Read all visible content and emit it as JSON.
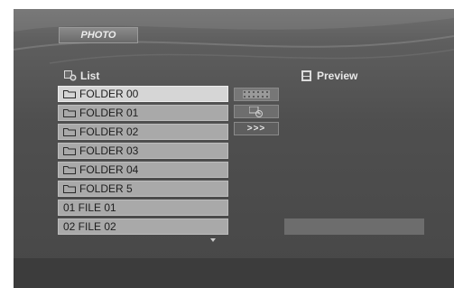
{
  "top_tab": {
    "label": "PHOTO"
  },
  "list_panel": {
    "title": "List",
    "icon": "list-photo-icon",
    "items": [
      {
        "label": "FOLDER 00",
        "type": "folder",
        "selected": true
      },
      {
        "label": "FOLDER 01",
        "type": "folder",
        "selected": false
      },
      {
        "label": "FOLDER 02",
        "type": "folder",
        "selected": false
      },
      {
        "label": "FOLDER 03",
        "type": "folder",
        "selected": false
      },
      {
        "label": "FOLDER 04",
        "type": "folder",
        "selected": false
      },
      {
        "label": "FOLDER 5",
        "type": "folder",
        "selected": false
      },
      {
        "label": "01 FILE 01",
        "type": "file",
        "selected": false
      },
      {
        "label": "02 FILE 02",
        "type": "file",
        "selected": false
      }
    ],
    "scroll_indicator": "chevron-down-icon"
  },
  "preview_panel": {
    "title": "Preview",
    "icon": "preview-icon"
  },
  "side_buttons": [
    {
      "name": "filmstrip-icon"
    },
    {
      "name": "slideshow-icon"
    },
    {
      "label": ">>>",
      "name": "next-page-button"
    }
  ]
}
